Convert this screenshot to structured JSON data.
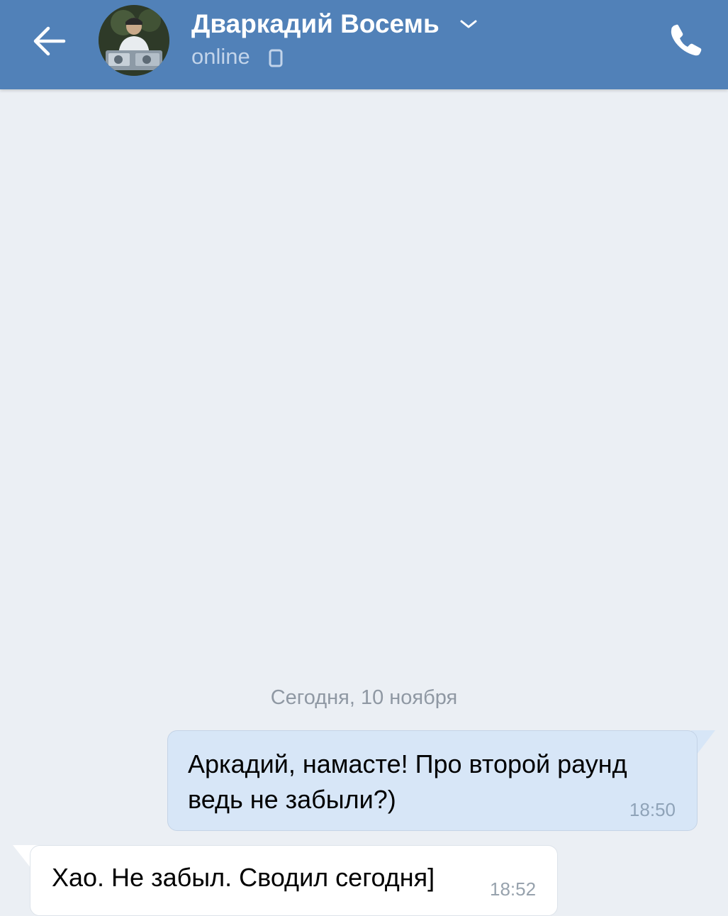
{
  "header": {
    "contact_name": "Дваркадий Восемь",
    "status": "online",
    "back_icon": "arrow-left-icon",
    "call_icon": "phone-icon",
    "status_device_icon": "mobile-icon",
    "background_color": "#5181b8"
  },
  "chat": {
    "date_separator": "Сегодня, 10 ноября",
    "messages": [
      {
        "direction": "outgoing",
        "text": "Аркадий, намасте! Про второй раунд ведь не забыли?)",
        "time": "18:50"
      },
      {
        "direction": "incoming",
        "text": "Хао. Не забыл. Сводил сегодня]",
        "time": "18:52"
      }
    ]
  }
}
